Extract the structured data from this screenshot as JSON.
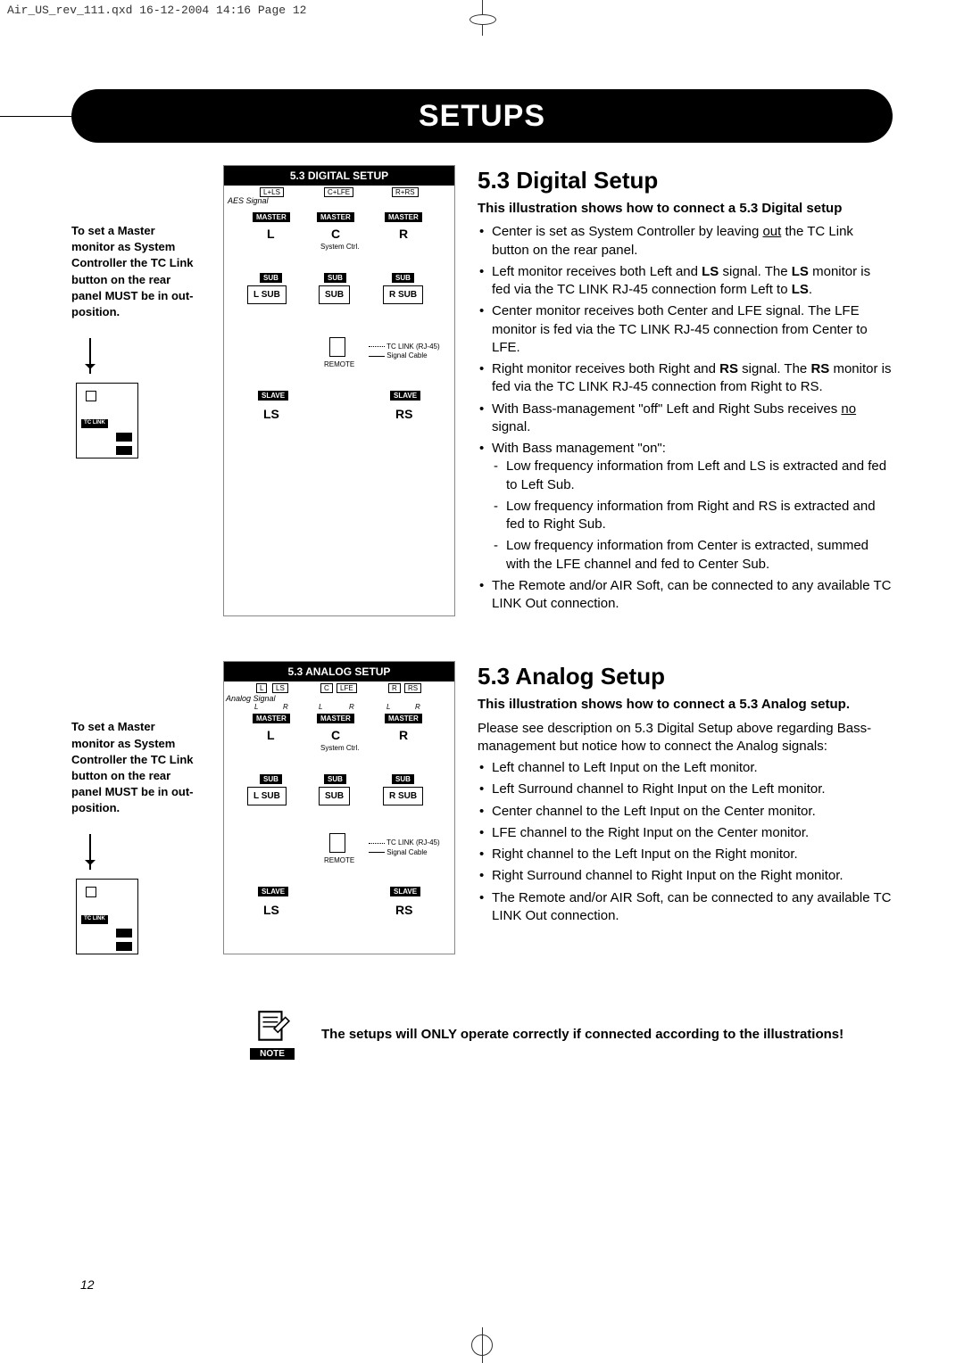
{
  "slug": "Air_US_rev_111.qxd  16-12-2004  14:16  Page 12",
  "banner": "SETUPS",
  "master_note": "To set a Master monitor as System Controller the TC Link button on the rear panel MUST be in out-position.",
  "diagram_digital": {
    "title": "5.3 DIGITAL SETUP",
    "signal": "AES Signal",
    "inputs": [
      "L+LS",
      "C+LFE",
      "R+RS"
    ],
    "master": "MASTER",
    "speakers": [
      "L",
      "C",
      "R"
    ],
    "system_ctrl": "System Ctrl.",
    "sub_label": "SUB",
    "subs": [
      "L SUB",
      "SUB",
      "R SUB"
    ],
    "remote": "REMOTE",
    "legend1": "TC LINK (RJ-45)",
    "legend2": "Signal Cable",
    "slave": "SLAVE",
    "rear": [
      "LS",
      "RS"
    ]
  },
  "diagram_analog": {
    "title": "5.3 ANALOG SETUP",
    "signal": "Analog Signal",
    "inputs": [
      "L",
      "LS",
      "C",
      "LFE",
      "R",
      "RS"
    ],
    "lr": [
      "L",
      "R"
    ],
    "master": "MASTER",
    "speakers": [
      "L",
      "C",
      "R"
    ],
    "system_ctrl": "System Ctrl.",
    "sub_label": "SUB",
    "subs": [
      "L SUB",
      "SUB",
      "R SUB"
    ],
    "remote": "REMOTE",
    "legend1": "TC LINK (RJ-45)",
    "legend2": "Signal Cable",
    "slave": "SLAVE",
    "rear": [
      "LS",
      "RS"
    ]
  },
  "digital": {
    "heading": "5.3 Digital Setup",
    "sub": "This illustration shows how to connect a 5.3 Digital setup",
    "b1a": "Center is set as System Controller by leaving ",
    "b1u": "out",
    "b1b": " the TC Link button on the rear panel.",
    "b2a": "Left monitor receives both Left and ",
    "b2b": "LS",
    "b2c": " signal. The ",
    "b2d": "LS",
    "b2e": " monitor is fed via the TC LINK RJ-45 connection form Left to ",
    "b2f": "LS",
    "b2g": ".",
    "b3": "Center monitor receives both Center and LFE signal. The LFE monitor is fed via the TC LINK RJ-45 connection from Center to LFE.",
    "b4a": "Right monitor receives both Right and ",
    "b4b": "RS",
    "b4c": " signal. The ",
    "b4d": "RS",
    "b4e": " monitor is fed via the TC LINK RJ-45 connection from Right to RS.",
    "b5a": "With Bass-management \"off\" Left and Right Subs receives ",
    "b5u": "no",
    "b5b": " signal.",
    "b6": "With Bass management \"on\":",
    "b6s1": "Low frequency information from Left and LS is extracted and fed to Left Sub.",
    "b6s2": "Low frequency information from Right and RS is extracted and fed to Right Sub.",
    "b6s3": "Low frequency information from Center is extracted, summed with the LFE channel and fed to Center Sub.",
    "b7": "The Remote and/or AIR Soft, can be connected to any available TC LINK Out connection."
  },
  "analog": {
    "heading": "5.3 Analog Setup",
    "sub": "This illustration shows how to connect a 5.3 Analog setup.",
    "intro": "Please see description on 5.3 Digital Setup above regarding Bass-management but notice how to connect the Analog signals:",
    "b1": "Left channel to Left Input on the Left monitor.",
    "b2": "Left Surround channel to Right Input on the Left monitor.",
    "b3": "Center channel to the Left Input on the Center monitor.",
    "b4": "LFE channel to the Right Input on the Center monitor.",
    "b5": "Right channel to the Left Input on the Right monitor.",
    "b6": "Right Surround channel to Right Input on the Right monitor.",
    "b7": "The Remote and/or AIR Soft, can be connected to any available TC LINK Out connection."
  },
  "note": {
    "label": "NOTE",
    "text": "The setups will ONLY operate correctly if connected according to the illustrations!"
  },
  "page_number": "12"
}
